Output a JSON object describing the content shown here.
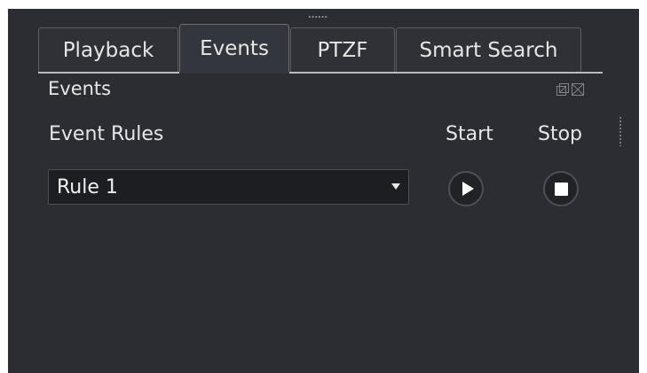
{
  "tabs": [
    {
      "label": "Playback",
      "active": false
    },
    {
      "label": "Events",
      "active": true
    },
    {
      "label": "PTZF",
      "active": false
    },
    {
      "label": "Smart Search",
      "active": false
    }
  ],
  "panel": {
    "title": "Events"
  },
  "event_rules": {
    "label": "Event Rules",
    "start_label": "Start",
    "stop_label": "Stop",
    "selected_rule": "Rule 1"
  },
  "dock_icons": [
    "float-icon",
    "close-icon"
  ],
  "colors": {
    "background": "#2b2d33",
    "text": "#e6e6e6",
    "dropdown_bg": "#1d1e22",
    "accent_white": "#ffffff"
  }
}
